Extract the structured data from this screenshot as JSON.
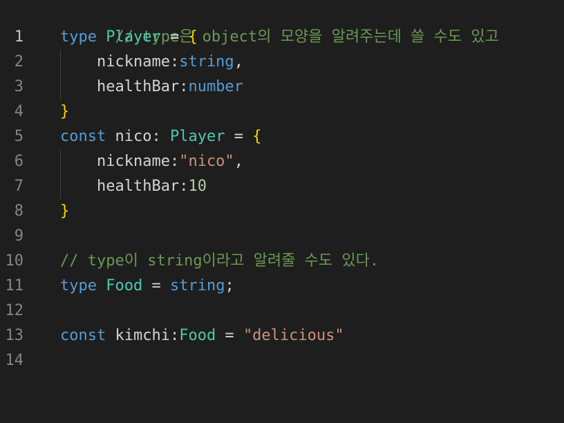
{
  "line_numbers": [
    "1",
    "2",
    "3",
    "4",
    "5",
    "6",
    "7",
    "8",
    "9",
    "10",
    "11",
    "12",
    "13",
    "14"
  ],
  "lines": {
    "l1": {
      "comment": "// type은 object의 모양을 알려주는데 쓸 수도 있고"
    },
    "l2": {
      "kw": "type",
      "name": "Player",
      "eq": " = ",
      "brace": "{"
    },
    "l3": {
      "prop": "nickname",
      "colon": ":",
      "type": "string",
      "comma": ","
    },
    "l4": {
      "prop": "healthBar",
      "colon": ":",
      "type": "number"
    },
    "l5": {
      "brace": "}"
    },
    "l6": {
      "kw": "const",
      "name": " nico",
      "colon": ": ",
      "type": "Player",
      "eq": " = ",
      "brace": "{"
    },
    "l7": {
      "prop": "nickname",
      "colon": ":",
      "value": "\"nico\"",
      "comma": ","
    },
    "l8": {
      "prop": "healthBar",
      "colon": ":",
      "value": "10"
    },
    "l9": {
      "brace": "}"
    },
    "l11": {
      "comment": "// type이 string이라고 알려줄 수도 있다."
    },
    "l12": {
      "kw": "type",
      "name": "Food",
      "eq": " = ",
      "type": "string",
      "semi": ";"
    },
    "l14": {
      "kw": "const",
      "name": " kimchi",
      "colon": ":",
      "type": "Food",
      "eq": " = ",
      "value": "\"delicious\""
    }
  },
  "colors": {
    "background": "#1e1e1e",
    "keyword": "#569cd6",
    "type": "#4ec9b0",
    "brace": "#ffd700",
    "property": "#9cdcfe",
    "string": "#ce9178",
    "number": "#b5cea8",
    "comment": "#6a9955"
  }
}
